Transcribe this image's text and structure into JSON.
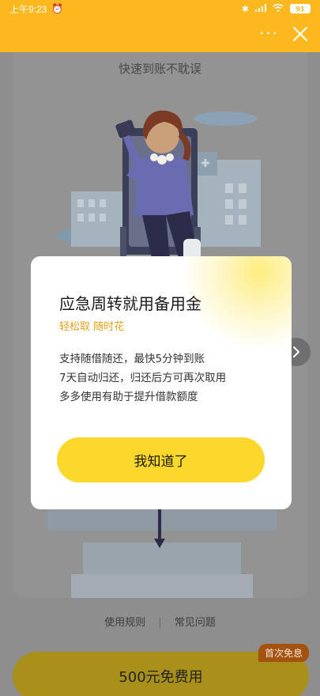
{
  "status_bar": {
    "time": "上午9:23",
    "battery": "91"
  },
  "header": {
    "more_label": "···"
  },
  "page": {
    "subtitle": "快速到账不耽误",
    "links": [
      "使用规则",
      "常见问题"
    ],
    "link_separator": "|",
    "cta_label": "500元免费用",
    "cta_badge": "首次免息"
  },
  "modal": {
    "title": "应急周转就用备用金",
    "tagline": "轻松取 随时花",
    "lines": [
      "支持随借随还，最快5分钟到账",
      "7天自动归还，归还后方可再次取用",
      "多多使用有助于提升借款额度"
    ],
    "button_label": "我知道了"
  },
  "colors": {
    "brand_yellow": "#fdb81f",
    "button_yellow": "#fdd82c",
    "tag_orange": "#e3a21b"
  }
}
